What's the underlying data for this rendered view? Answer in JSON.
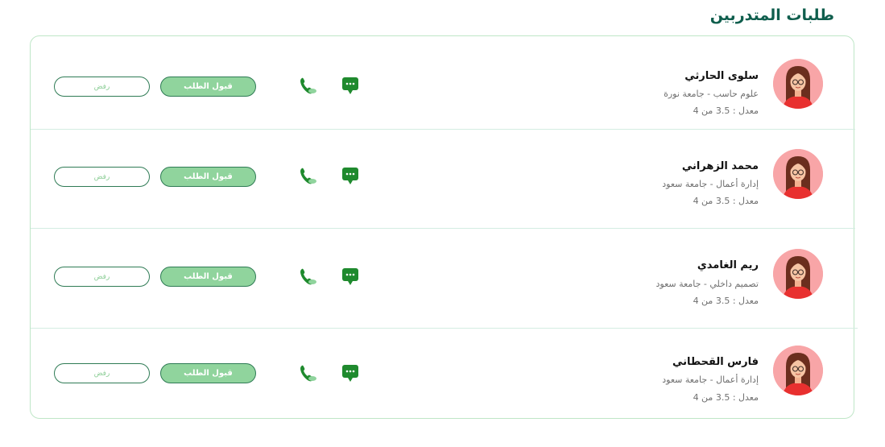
{
  "page": {
    "title": "طلبات المتدربين"
  },
  "colors": {
    "primary": "#0f5e4d",
    "accent": "#90d49d",
    "icon_green": "#1f8a2e",
    "avatar_bg": "#f8a5a7",
    "card_border": "#bfe6c7"
  },
  "requests": [
    {
      "name": "سلوى الحارثي",
      "major": "علوم حاسب - جامعة نورة",
      "gpa": "معدل : 3.5 من 4",
      "accept_label": "قبول الطلب",
      "reject_label": "رفض",
      "chat_icon": "chat-bubble-icon",
      "phone_icon": "phone-icon"
    },
    {
      "name": "محمد الزهراني",
      "major": "إدارة أعمال - جامعة سعود",
      "gpa": "معدل : 3.5 من 4",
      "accept_label": "قبول الطلب",
      "reject_label": "رفض",
      "chat_icon": "chat-bubble-icon",
      "phone_icon": "phone-icon"
    },
    {
      "name": "ريم الغامدي",
      "major": "تصميم داخلي - جامعة سعود",
      "gpa": "معدل : 3.5 من 4",
      "accept_label": "قبول الطلب",
      "reject_label": "رفض",
      "chat_icon": "chat-bubble-icon",
      "phone_icon": "phone-icon"
    },
    {
      "name": "فارس القحطاني",
      "major": "إدارة أعمال - جامعة سعود",
      "gpa": "معدل : 3.5 من 4",
      "accept_label": "قبول الطلب",
      "reject_label": "رفض",
      "chat_icon": "chat-bubble-icon",
      "phone_icon": "phone-icon"
    }
  ]
}
